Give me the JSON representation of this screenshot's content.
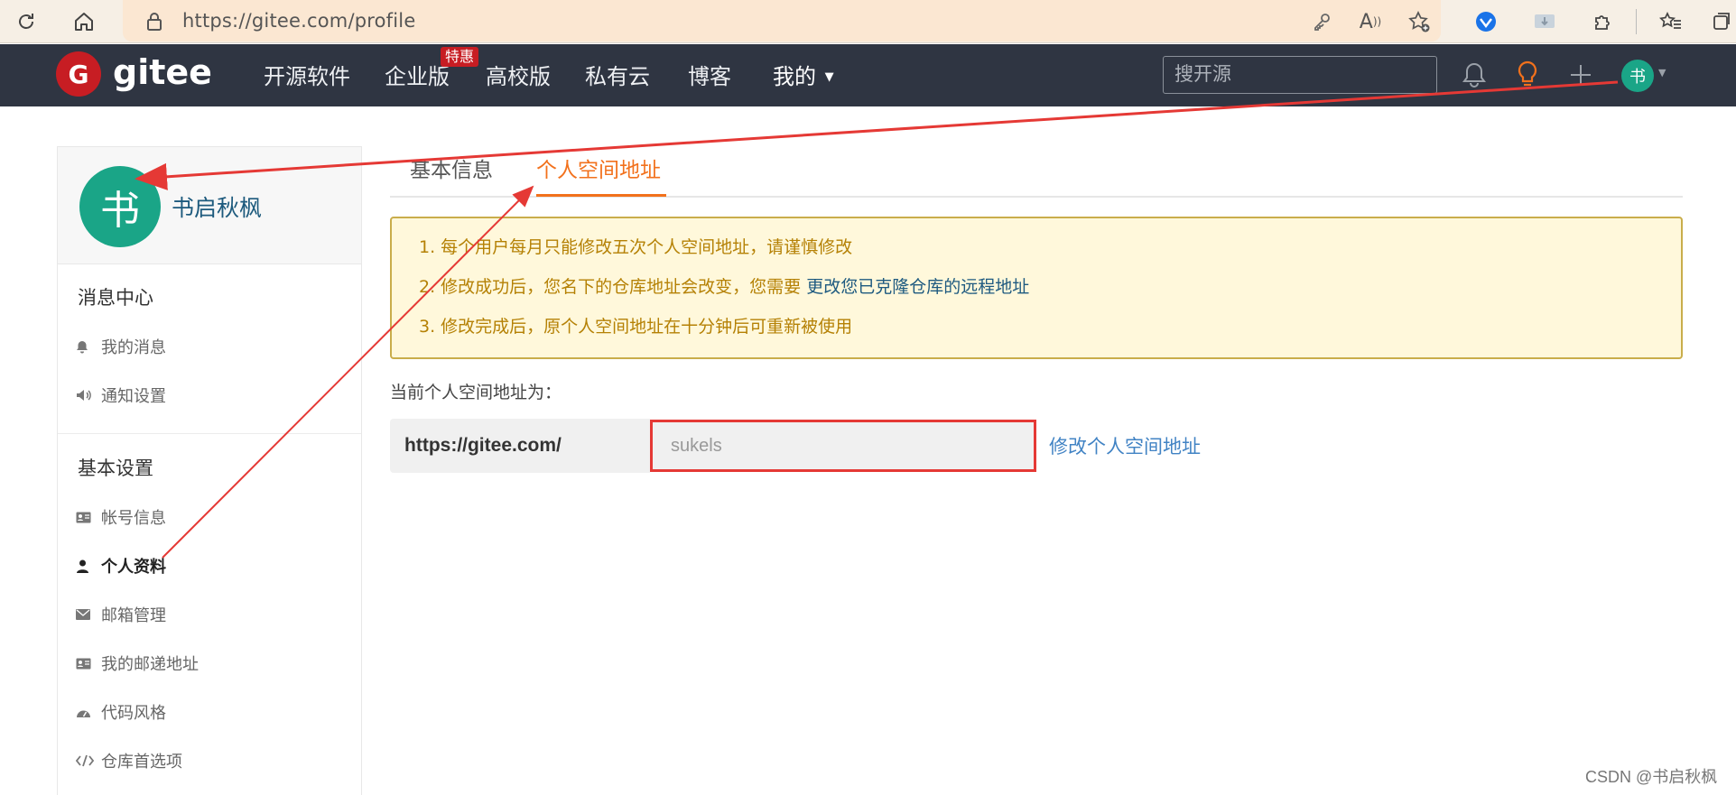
{
  "browser": {
    "url": "https://gitee.com/profile",
    "icons": [
      "refresh-icon",
      "home-icon",
      "lock-icon",
      "key-icon",
      "read-aloud-icon",
      "favorite-add-icon",
      "extension-icon",
      "collections-icon",
      "favorites-icon"
    ]
  },
  "navbar": {
    "logo_mark": "G",
    "logo_text": "gitee",
    "items": [
      {
        "label": "开源软件"
      },
      {
        "label": "企业版",
        "badge": "特惠"
      },
      {
        "label": "高校版"
      },
      {
        "label": "私有云"
      },
      {
        "label": "博客"
      },
      {
        "label": "我的"
      }
    ],
    "search_placeholder": "搜开源",
    "avatar_char": "书"
  },
  "sidebar": {
    "avatar_char": "书",
    "username": "书启秋枫",
    "sections": [
      {
        "title": "消息中心",
        "items": [
          "我的消息",
          "通知设置"
        ]
      },
      {
        "title": "基本设置",
        "items": [
          "帐号信息",
          "个人资料",
          "邮箱管理",
          "我的邮递地址",
          "代码风格",
          "仓库首选项"
        ]
      }
    ],
    "active_item": "个人资料"
  },
  "main": {
    "tabs": [
      {
        "label": "基本信息"
      },
      {
        "label": "个人空间地址"
      }
    ],
    "active_tab": "个人空间地址",
    "notice": {
      "line1": "1. 每个用户每月只能修改五次个人空间地址，请谨慎修改",
      "line2_prefix": "2. 修改成功后，您名下的仓库地址会改变，您需要",
      "line2_link": "更改您已克隆仓库的远程地址",
      "line3": "3. 修改完成后，原个人空间地址在十分钟后可重新被使用"
    },
    "current_label": "当前个人空间地址为：",
    "url_prefix": "https://gitee.com/",
    "space_value": "sukels",
    "change_link": "修改个人空间地址"
  },
  "watermark": "CSDN @书启秋枫",
  "colors": {
    "navbar_bg": "#2f3542",
    "accent_orange": "#f2711c",
    "avatar_green": "#1aa587",
    "brand_red": "#c71d23",
    "annotation_red": "#e53935",
    "notice_bg": "#fff8db",
    "notice_text": "#b58105",
    "link_blue": "#4183c4"
  }
}
